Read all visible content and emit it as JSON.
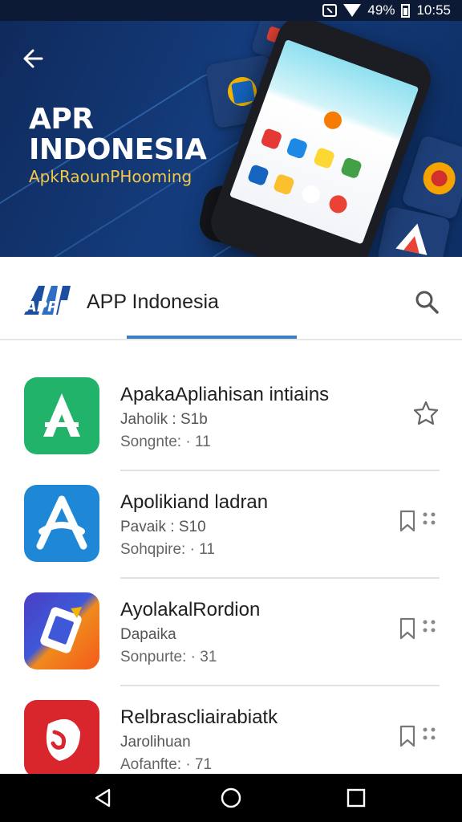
{
  "status_bar": {
    "battery_percent": "49%",
    "time": "10:55",
    "icons": [
      "nfc-icon",
      "wifi-icon",
      "battery-icon"
    ]
  },
  "banner": {
    "title_line1": "APR",
    "title_line2": "INDONESIA",
    "subtitle": "ApkRaounPHooming"
  },
  "header": {
    "app_name": "APP Indonesia",
    "logo_text": "APP"
  },
  "apps": [
    {
      "name": "ApakaApliahisan intiains",
      "line2": "Jaholik : S1b",
      "line3": "Songnte: · 11",
      "action": "star-icon"
    },
    {
      "name": "Apolikiand ladran",
      "line2": "Pavaik : S10",
      "line3": "Sohqpire: · 11",
      "action": "bookmark-icon"
    },
    {
      "name": "AyolakalRordion",
      "line2": "Dapaika",
      "line3": "Sonpurte: · 31",
      "action": "bookmark-icon"
    },
    {
      "name": "Relbrascliairabiatk",
      "line2": "Jarolihuan",
      "line3": "Aofanfte: · 71",
      "action": "bookmark-icon"
    }
  ],
  "colors": {
    "banner_bg": "#143c7c",
    "accent": "#3a7fc1",
    "subtitle": "#f2c84b",
    "icon1": "#22b36b",
    "icon2": "#1e88d6",
    "icon4": "#d9262c"
  }
}
